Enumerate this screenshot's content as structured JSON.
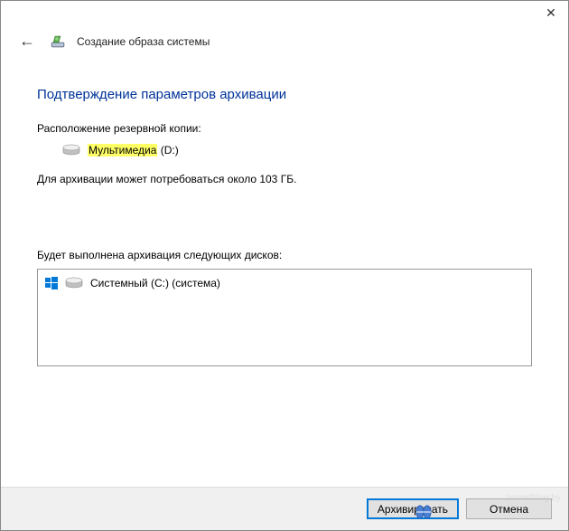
{
  "titlebar": {
    "close_symbol": "✕"
  },
  "header": {
    "back_symbol": "←",
    "window_title": "Создание образа системы"
  },
  "main": {
    "heading": "Подтверждение параметров архивации",
    "location_label": "Расположение резервной копии:",
    "location_highlighted": "Мультимедиа",
    "location_suffix": " (D:)",
    "size_text": "Для архивации может потребоваться около 103 ГБ.",
    "drives_label": "Будет выполнена архивация следующих дисков:",
    "drives": [
      {
        "name": "Системный (C:) (система)"
      }
    ]
  },
  "footer": {
    "archive_label": "Архивировать",
    "cancel_label": "Отмена"
  },
  "watermark": "pronetblog.by"
}
